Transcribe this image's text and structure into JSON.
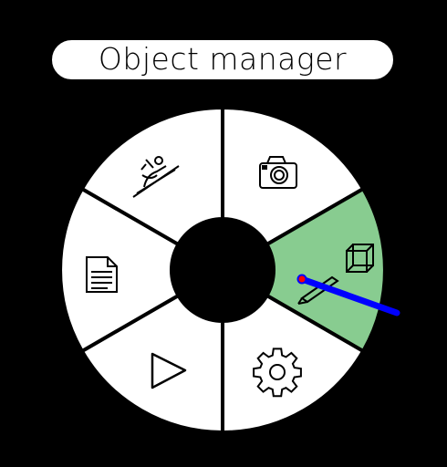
{
  "menu": {
    "title": "Object manager",
    "segments": [
      {
        "id": "camera",
        "icon": "camera-icon",
        "selected": false
      },
      {
        "id": "create-object",
        "icon": "cube-pencil-icon",
        "selected": true
      },
      {
        "id": "settings",
        "icon": "gear-icon",
        "selected": false
      },
      {
        "id": "play",
        "icon": "play-icon",
        "selected": false
      },
      {
        "id": "document",
        "icon": "document-icon",
        "selected": false
      },
      {
        "id": "skier",
        "icon": "skier-icon",
        "selected": false
      }
    ]
  },
  "colors": {
    "background": "#000000",
    "segment": "#ffffff",
    "selected_segment": "#88cc90",
    "pointer": "#0000ff",
    "pointer_origin": "#ff0000"
  }
}
